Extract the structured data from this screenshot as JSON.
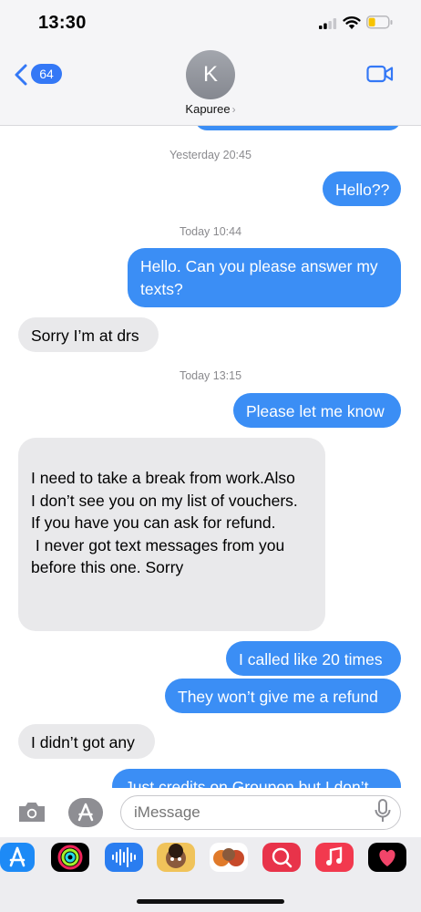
{
  "status_bar": {
    "time": "13:30"
  },
  "header": {
    "back_badge": "64",
    "avatar_initial": "K",
    "contact_name": "Kapuree",
    "contact_chevron": "›"
  },
  "messages": [
    {
      "type": "stamp",
      "text": "Yesterday 20:45"
    },
    {
      "type": "outgoing",
      "text": "Hello??"
    },
    {
      "type": "stamp",
      "text": "Today 10:44"
    },
    {
      "type": "outgoing",
      "lines": [
        "Hello. Can you please answer my",
        "texts?"
      ]
    },
    {
      "type": "incoming",
      "text": "Sorry I’m at drs"
    },
    {
      "type": "stamp",
      "text": "Today 13:15"
    },
    {
      "type": "outgoing",
      "text": "Please let me know"
    },
    {
      "type": "incoming",
      "lines": [
        "I need to take a break from work.Also",
        "I don’t see you on my list of vouchers.",
        "If you have you can ask for refund.",
        " I never got text messages from you",
        "before this one. Sorry"
      ]
    },
    {
      "type": "outgoing",
      "text": "I called like 20 times"
    },
    {
      "type": "outgoing",
      "text": "They won’t give me a refund"
    },
    {
      "type": "incoming",
      "text": "I didn’t got any"
    },
    {
      "type": "outgoing",
      "text": "Just credits on Groupon but I don’t"
    }
  ],
  "compose": {
    "placeholder": "iMessage"
  },
  "app_drawer": {
    "apps": [
      "app-store-icon",
      "activity-rings-icon",
      "audio-message-icon",
      "memoji-icon",
      "memoji-stickers-icon",
      "web-search-icon",
      "music-icon",
      "digital-touch-icon"
    ]
  },
  "colors": {
    "outgoing_bubble": "#3b8ef5",
    "incoming_bubble": "#e9e9eb",
    "accent": "#3478f6"
  }
}
